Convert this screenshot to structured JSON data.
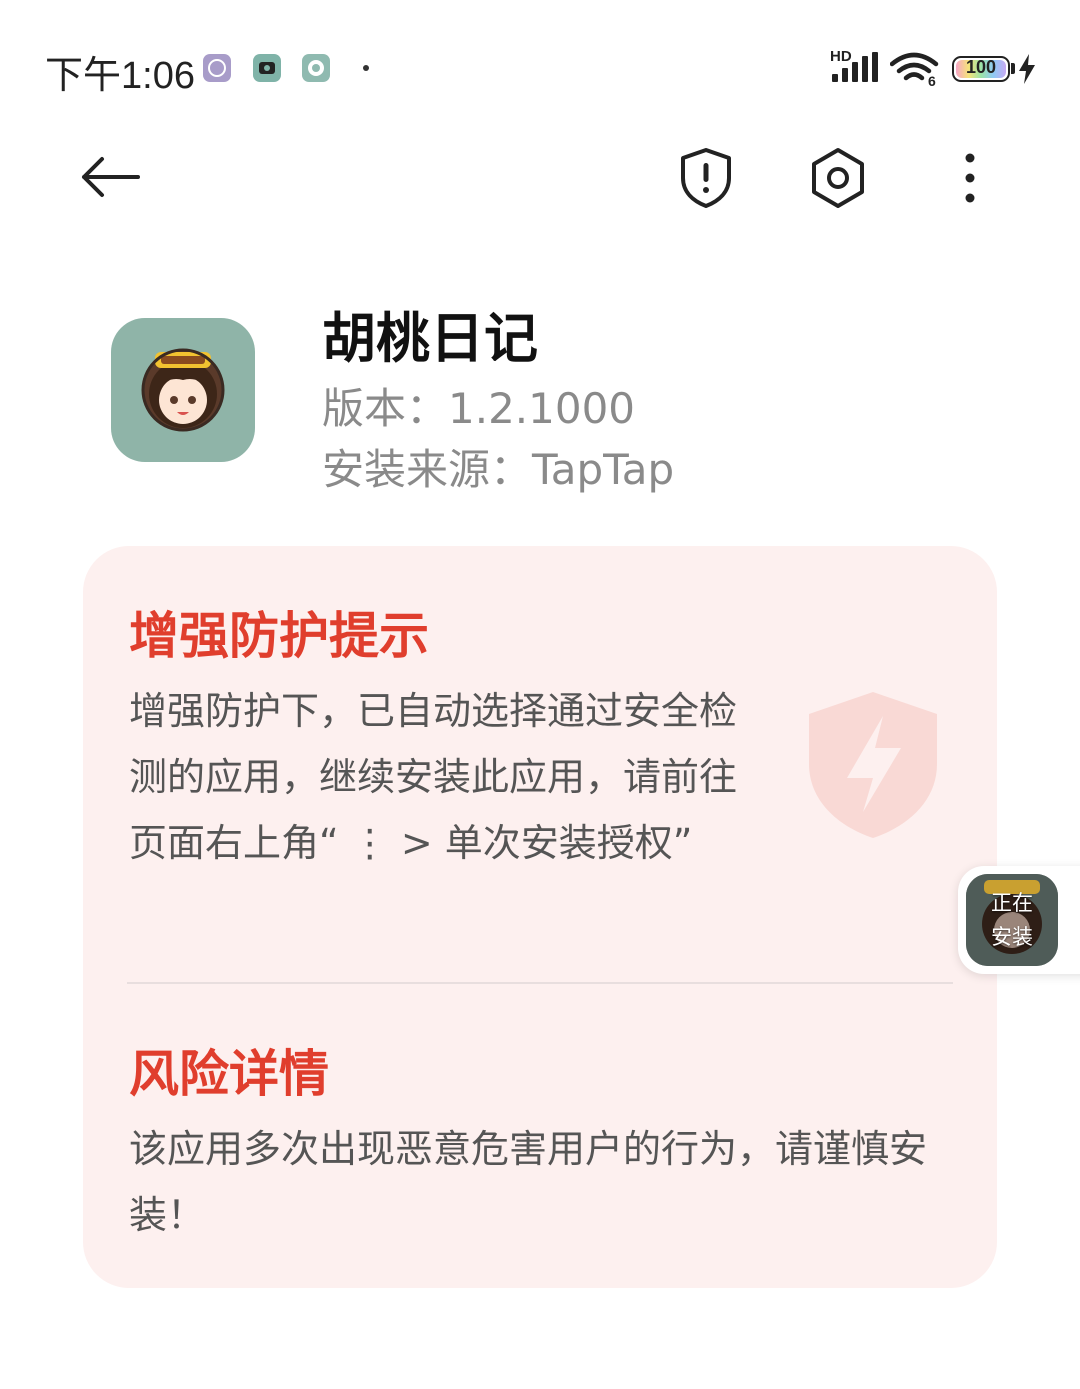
{
  "status_bar": {
    "time": "下午1:06",
    "network_label": "HD",
    "battery_level": "100",
    "notification_icons": [
      "compass-app-icon",
      "camera-app-icon",
      "game-app-icon"
    ]
  },
  "toolbar": {
    "back_icon": "arrow-left-icon",
    "security_icon": "shield-alert-icon",
    "settings_icon": "gear-icon",
    "more_icon": "more-vertical-icon"
  },
  "app": {
    "name": "胡桃日记",
    "version": "版本：1.2.1000",
    "source": "安装来源：TapTap"
  },
  "warning": {
    "title": "增强防护提示",
    "text": "增强防护下，已自动选择通过安全检测的应用，继续安装此应用，请前往页面右上角“ ⋮ > 单次安装授权”",
    "risk_title": "风险详情",
    "risk_text": "该应用多次出现恶意危害用户的行为，请谨慎安装！"
  },
  "installing": {
    "label": "正在\n安装"
  },
  "colors": {
    "accent_red": "#e03e2d",
    "card_bg": "#fdf0ef",
    "icon_bg": "#8fb4a8"
  }
}
